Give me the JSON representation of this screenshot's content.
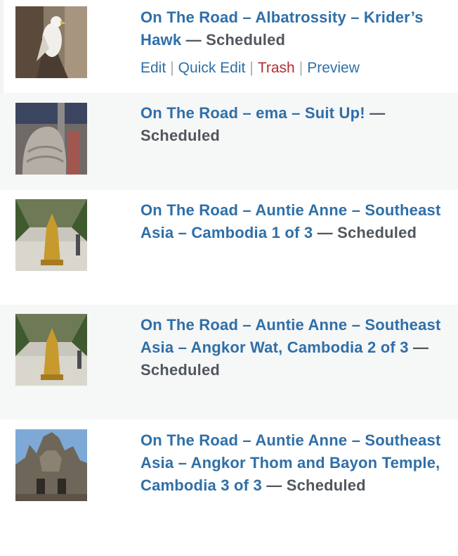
{
  "posts": [
    {
      "title": "On The Road – Albatrossity – Krider’s Hawk",
      "separator": " — ",
      "state": "Scheduled",
      "thumbnail_icon": "hawk-photo",
      "actions": {
        "edit": "Edit",
        "quick_edit": "Quick Edit",
        "trash": "Trash",
        "preview": "Preview",
        "divider": "|"
      }
    },
    {
      "title": "On The Road – ema – Suit Up!",
      "separator": " — ",
      "state": "Scheduled",
      "thumbnail_icon": "armor-photo"
    },
    {
      "title": "On The Road – Auntie Anne – Southeast Asia – Cambodia 1 of 3",
      "separator": " — ",
      "state": "Scheduled",
      "thumbnail_icon": "airport-stupa-photo"
    },
    {
      "title": "On The Road – Auntie Anne – Southeast Asia – Angkor Wat, Cambodia 2 of 3",
      "separator": " — ",
      "state": "Scheduled",
      "thumbnail_icon": "airport-stupa-photo"
    },
    {
      "title": "On The Road – Auntie Anne – Southeast Asia – Angkor Thom and Bayon Temple, Cambodia 3 of 3",
      "separator": " — ",
      "state": "Scheduled",
      "thumbnail_icon": "bayon-temple-photo"
    }
  ],
  "colors": {
    "link": "#2f6fa8",
    "state": "#50575e",
    "trash": "#b32d2e",
    "row_alt": "#f6f7f7"
  }
}
